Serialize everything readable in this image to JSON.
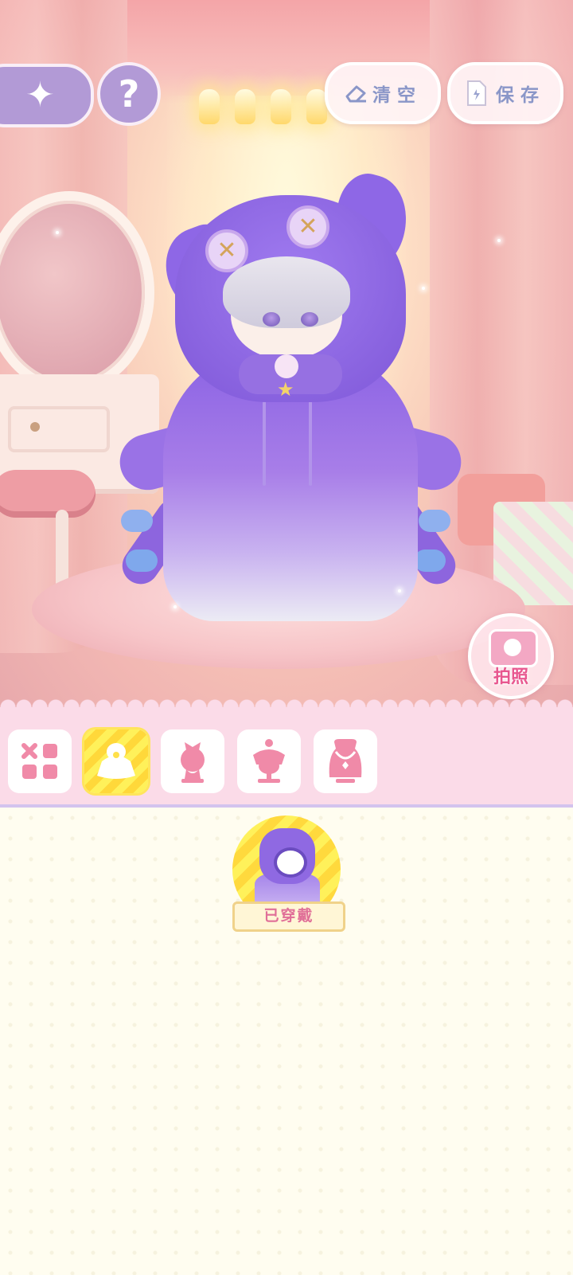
{
  "toolbar": {
    "clear_label": "清空",
    "save_label": "保存",
    "help_label": "?"
  },
  "camera": {
    "label": "拍照"
  },
  "categories": [
    {
      "icon": "all-items-icon",
      "selected": false
    },
    {
      "icon": "outfit-icon",
      "selected": true
    },
    {
      "icon": "hair-accessory-icon",
      "selected": false
    },
    {
      "icon": "head-accessory-icon",
      "selected": false
    },
    {
      "icon": "necklace-icon",
      "selected": false
    }
  ],
  "items": [
    {
      "name": "purple-octopus-hoodie",
      "status_label": "已穿戴",
      "equipped": true
    }
  ],
  "colors": {
    "accent_purple": "#b29ad6",
    "category_bar": "#fbdbe8",
    "selected_yellow": "#ffe55c",
    "label_pink": "#e06f98",
    "button_text_blue": "#8a96c8"
  }
}
